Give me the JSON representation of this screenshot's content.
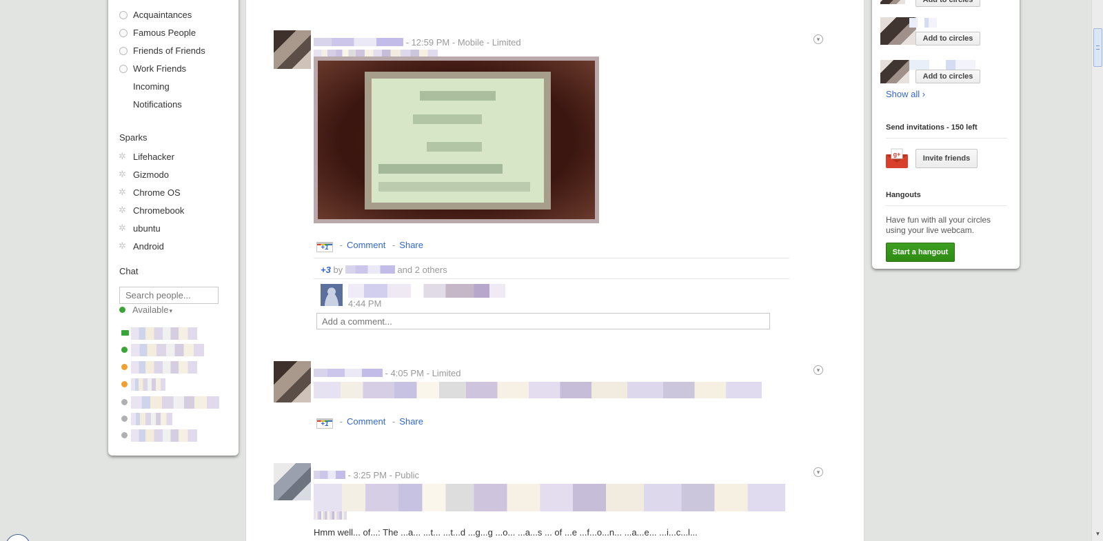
{
  "circles": [
    "Acquaintances",
    "Famous People",
    "Friends of Friends",
    "Work Friends"
  ],
  "nav": [
    "Incoming",
    "Notifications"
  ],
  "sparks": {
    "title": "Sparks",
    "items": [
      "Lifehacker",
      "Gizmodo",
      "Chrome OS",
      "Chromebook",
      "ubuntu",
      "Android"
    ]
  },
  "chat": {
    "title": "Chat",
    "search_placeholder": "Search people...",
    "status": "Available",
    "status_caret": "▾"
  },
  "posts": [
    {
      "time": "12:59 PM",
      "via": "Mobile",
      "visibility": "Limited",
      "plusone_label": "+1",
      "comment_label": "Comment",
      "share_label": "Share",
      "plus_count": "+3",
      "by_label": "by",
      "others_label": "and 2 others",
      "comment_time": "4:44 PM",
      "add_comment_placeholder": "Add a comment..."
    },
    {
      "time": "4:05 PM",
      "visibility": "Limited",
      "plusone_label": "+1",
      "comment_label": "Comment",
      "share_label": "Share"
    },
    {
      "time": "3:25 PM",
      "visibility": "Public",
      "body_partial": "Hmm well... of...: The ...a... ...t... ...t...d ...g...g ...o... ...a...s ... of ...e ...f...o...n... ...a...e... ...i...c...l..."
    }
  ],
  "suggestions": {
    "add_label": "Add to circles",
    "show_all": "Show all ›"
  },
  "invitations": {
    "title": "Send invitations - 150 left",
    "button": "Invite friends"
  },
  "hangouts": {
    "title": "Hangouts",
    "text": "Have fun with all your circles using your live webcam.",
    "button": "Start a hangout"
  },
  "colors": {
    "link": "#3366cc",
    "online": "#3aa536",
    "idle": "#f0a030",
    "hangout_button": "#2e8b14"
  },
  "icons": {
    "post_menu": "dropdown-circle-icon",
    "invite": "gplus-envelope-icon",
    "spark": "sparkle-icon",
    "camera": "video-camera-icon"
  }
}
